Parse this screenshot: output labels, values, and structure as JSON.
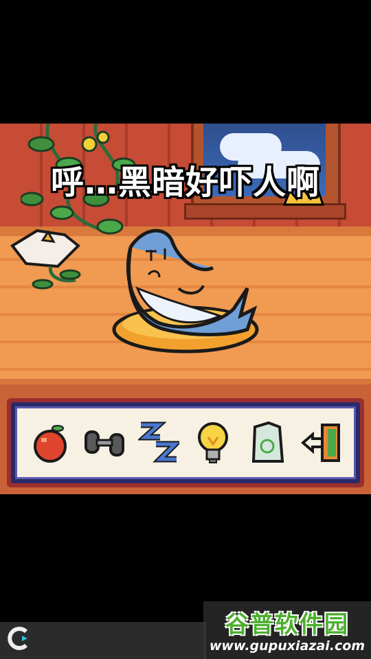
{
  "dialog": {
    "text": "呼…黑暗好吓人啊"
  },
  "toolbar": {
    "buttons": [
      {
        "name": "apple-icon",
        "action": "feed"
      },
      {
        "name": "dumbbell-icon",
        "action": "exercise"
      },
      {
        "name": "sleep-zzz-icon",
        "action": "sleep"
      },
      {
        "name": "lightbulb-icon",
        "action": "light"
      },
      {
        "name": "trash-bag-icon",
        "action": "clean"
      },
      {
        "name": "exit-door-icon",
        "action": "exit"
      }
    ]
  },
  "watermark": {
    "title": "谷普软件园",
    "url": "www.gupuxiazai.com"
  },
  "colors": {
    "wall": "#c64c36",
    "floor": "#f09a52",
    "toolbar_border": "#5a5ab0",
    "shark": "#6f9fd6",
    "cushion": "#f2a12e"
  }
}
